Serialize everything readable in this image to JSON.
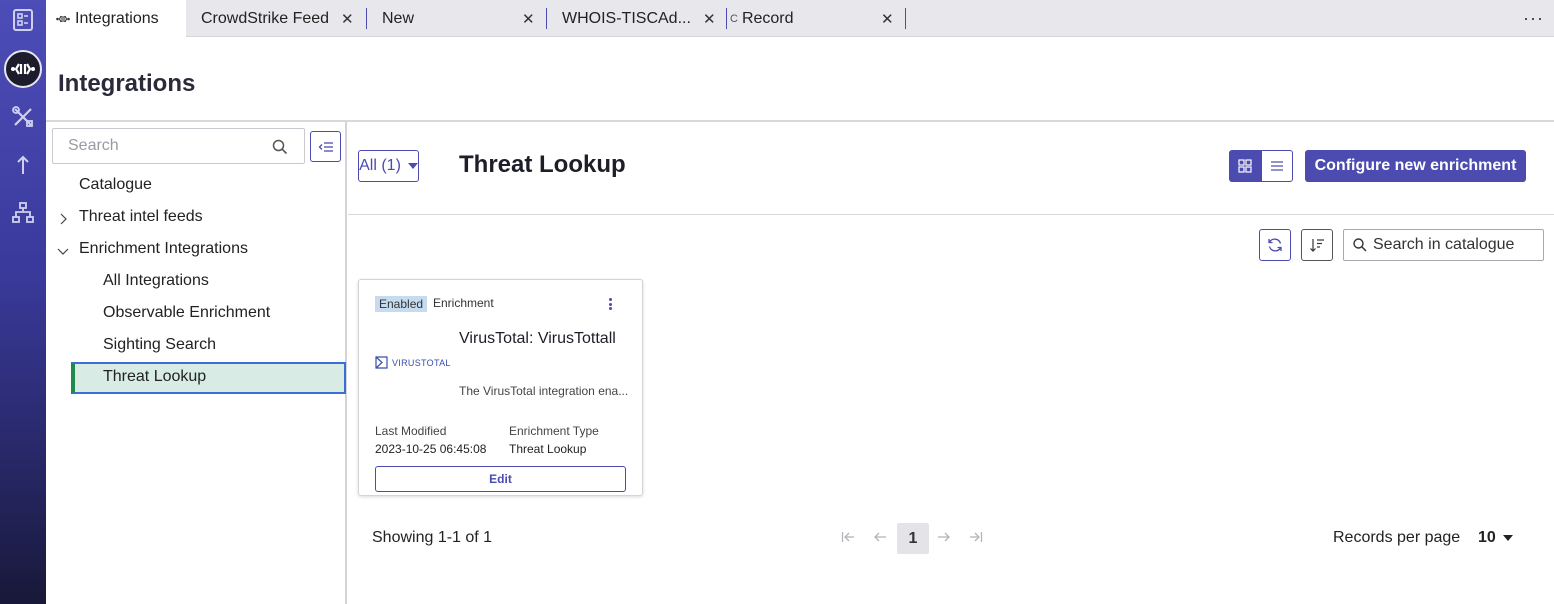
{
  "colors": {
    "accent": "#4b4bb0",
    "selected_bg": "#d8ece5",
    "selected_bar": "#1f8a4c",
    "badge_bg": "#c5dcf0"
  },
  "rail": {
    "icons": [
      "dashboard-icon",
      "integrations-logo-icon",
      "tools-icon",
      "upload-icon",
      "hierarchy-icon"
    ]
  },
  "tabs": [
    {
      "label": "Integrations",
      "icon": "integrations-icon",
      "active": true
    },
    {
      "label": "CrowdStrike Feed",
      "closable": true
    },
    {
      "label": "New",
      "closable": true
    },
    {
      "label": "WHOIS-TISCAd...",
      "closable": true
    },
    {
      "label": "Record",
      "prefix": "C",
      "closable": true
    }
  ],
  "tabs_more": "···",
  "page": {
    "title": "Integrations"
  },
  "left_panel": {
    "search_placeholder": "Search",
    "tree": [
      {
        "label": "Catalogue"
      },
      {
        "label": "Threat intel feeds",
        "expanded": false
      },
      {
        "label": "Enrichment Integrations",
        "expanded": true
      },
      {
        "label": "All Integrations"
      },
      {
        "label": "Observable Enrichment"
      },
      {
        "label": "Sighting Search"
      },
      {
        "label": "Threat Lookup",
        "selected": true
      }
    ]
  },
  "main": {
    "filter_label": "All (1)",
    "title": "Threat Lookup",
    "configure_button": "Configure new enrichment",
    "catalogue_search_placeholder": "Search in catalogue"
  },
  "card": {
    "badge": "Enabled",
    "type": "Enrichment",
    "logo_text": "VIRUSTOTAL",
    "title": "VirusTotal: VirusTottall",
    "description": "The VirusTotal integration ena...",
    "last_modified_label": "Last Modified",
    "last_modified_value": "2023-10-25 06:45:08",
    "enrichment_type_label": "Enrichment Type",
    "enrichment_type_value": "Threat Lookup",
    "edit_label": "Edit"
  },
  "pagination": {
    "showing": "Showing 1-1 of 1",
    "current_page": "1",
    "records_per_page_label": "Records per page",
    "records_per_page_value": "10"
  }
}
